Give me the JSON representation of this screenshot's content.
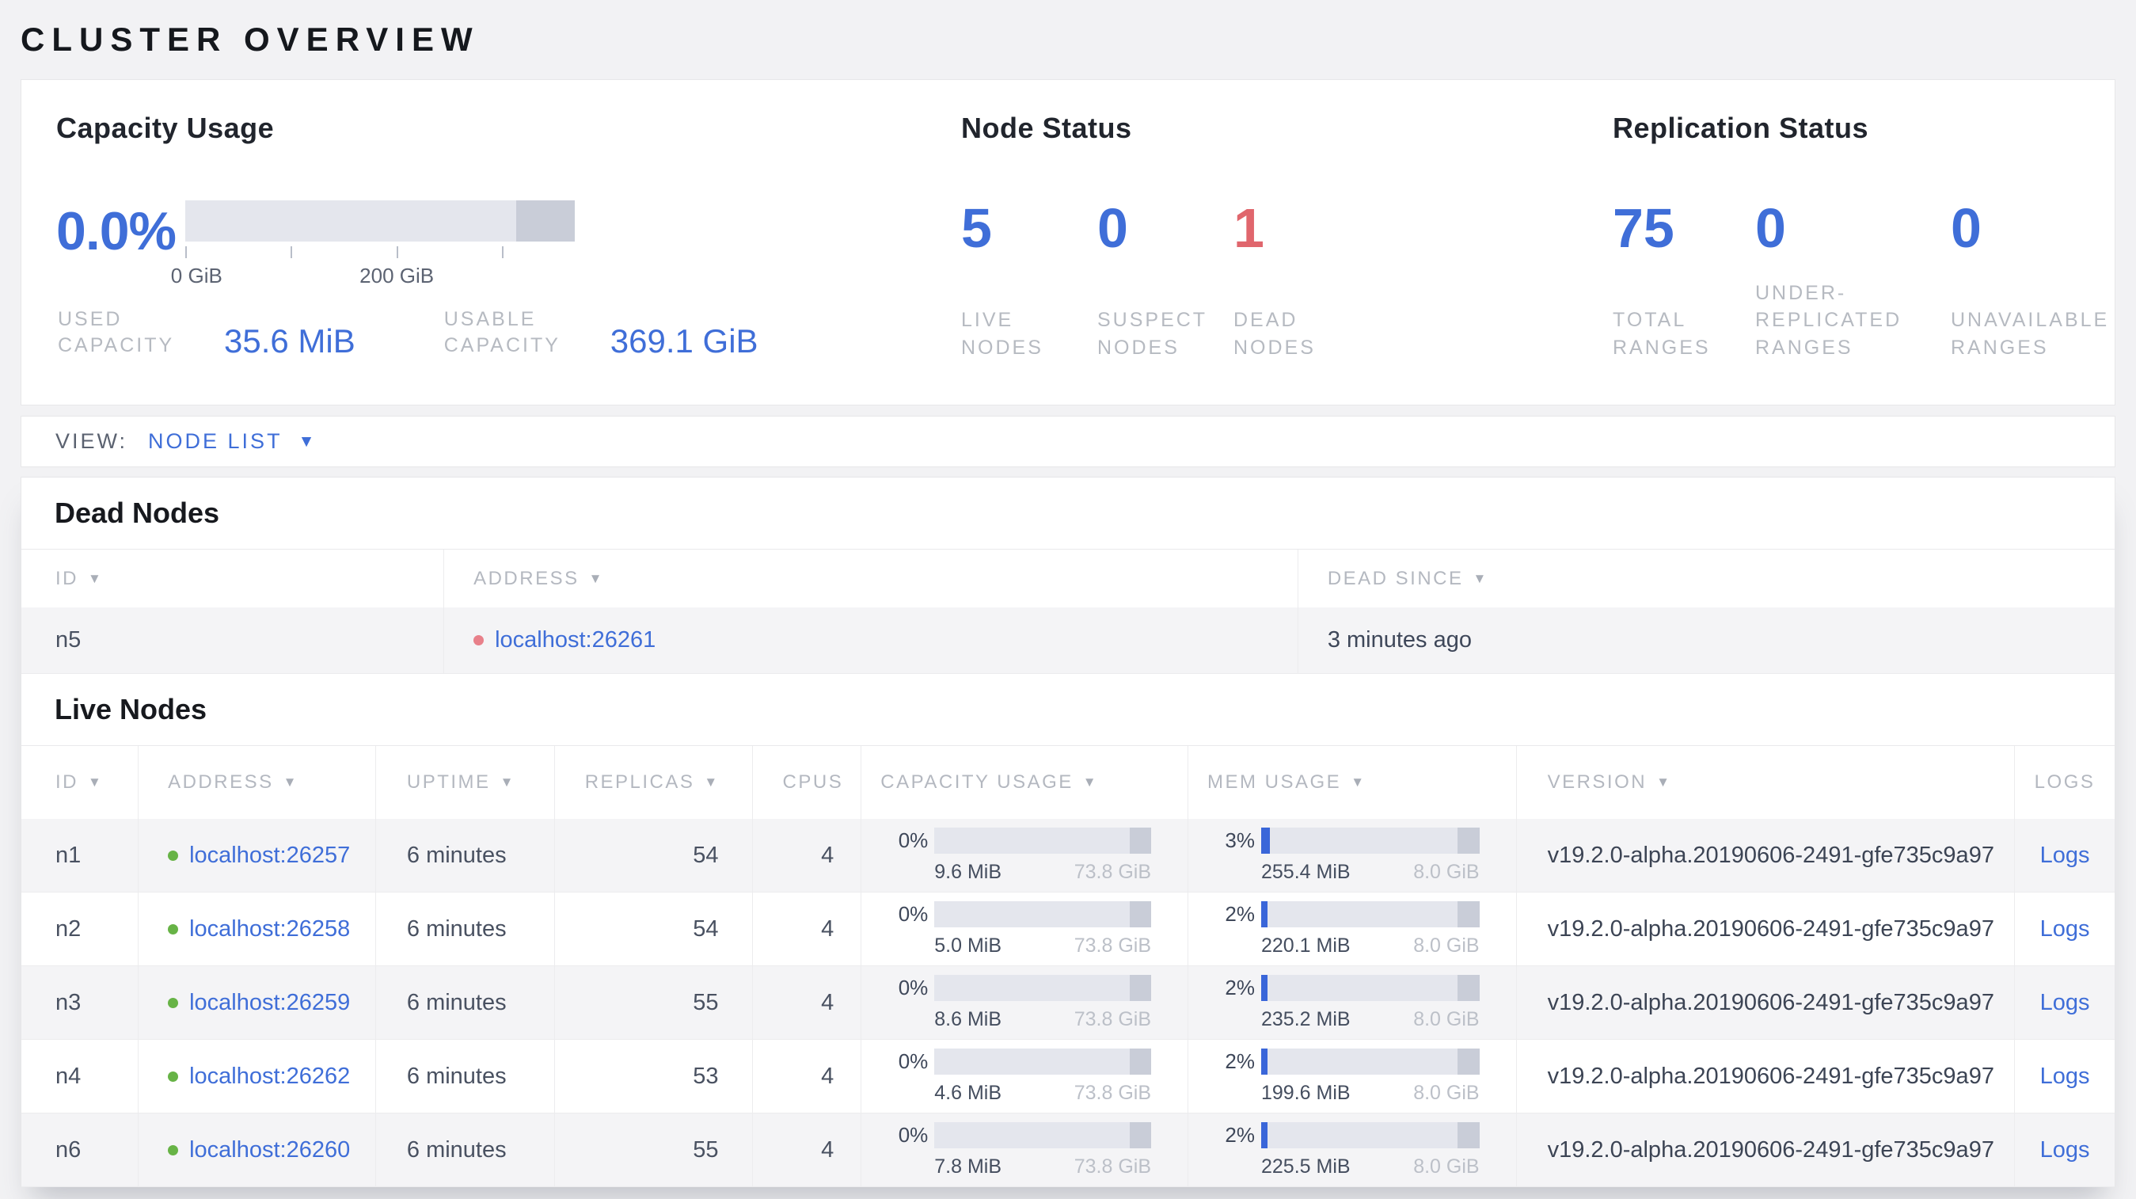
{
  "page_title": "CLUSTER OVERVIEW",
  "colors": {
    "accent_blue": "#3f6ed8",
    "danger_red": "#e0666d",
    "live_dot_green": "#67b346",
    "dead_dot_red": "#e8808a",
    "bar_track": "#e4e6ed",
    "bar_end_segment": "#c9cdd8",
    "bar_fill_blue": "#3a66d9"
  },
  "icons": {
    "sort_desc": "▼",
    "dropdown_caret": "▼"
  },
  "summary": {
    "capacity": {
      "title": "Capacity Usage",
      "percent": "0.0%",
      "axis_tick_labels": [
        "0 GiB",
        "200 GiB"
      ],
      "used_label": "USED CAPACITY",
      "used_value": "35.6 MiB",
      "usable_label": "USABLE CAPACITY",
      "usable_value": "369.1 GiB"
    },
    "node_status": {
      "title": "Node Status",
      "metrics": [
        {
          "value": "5",
          "label": "LIVE NODES"
        },
        {
          "value": "0",
          "label": "SUSPECT NODES"
        },
        {
          "value": "1",
          "label": "DEAD NODES"
        }
      ]
    },
    "replication": {
      "title": "Replication Status",
      "metrics": [
        {
          "value": "75",
          "label": "TOTAL RANGES"
        },
        {
          "value": "0",
          "label": "UNDER-REPLICATED RANGES"
        },
        {
          "value": "0",
          "label": "UNAVAILABLE RANGES"
        }
      ]
    }
  },
  "view_bar": {
    "label": "VIEW:",
    "selected": "NODE LIST"
  },
  "dead_nodes": {
    "title": "Dead Nodes",
    "columns": [
      {
        "label": "ID"
      },
      {
        "label": "ADDRESS"
      },
      {
        "label": "DEAD SINCE"
      }
    ],
    "rows": [
      {
        "id": "n5",
        "address": "localhost:26261",
        "dead_since": "3 minutes ago"
      }
    ]
  },
  "live_nodes": {
    "title": "Live Nodes",
    "columns": [
      {
        "label": "ID"
      },
      {
        "label": "ADDRESS"
      },
      {
        "label": "UPTIME"
      },
      {
        "label": "REPLICAS"
      },
      {
        "label": "CPUS"
      },
      {
        "label": "CAPACITY USAGE"
      },
      {
        "label": "MEM USAGE"
      },
      {
        "label": "VERSION"
      },
      {
        "label": "LOGS"
      }
    ],
    "logs_label": "Logs",
    "rows": [
      {
        "id": "n1",
        "address": "localhost:26257",
        "uptime": "6 minutes",
        "replicas": "54",
        "cpus": "4",
        "cap_pct": "0%",
        "cap_used": "9.6 MiB",
        "cap_total": "73.8 GiB",
        "cap_fill": "0",
        "mem_pct": "3%",
        "mem_used": "255.4 MiB",
        "mem_total": "8.0 GiB",
        "mem_fill": "4",
        "version": "v19.2.0-alpha.20190606-2491-gfe735c9a97"
      },
      {
        "id": "n2",
        "address": "localhost:26258",
        "uptime": "6 minutes",
        "replicas": "54",
        "cpus": "4",
        "cap_pct": "0%",
        "cap_used": "5.0 MiB",
        "cap_total": "73.8 GiB",
        "cap_fill": "0",
        "mem_pct": "2%",
        "mem_used": "220.1 MiB",
        "mem_total": "8.0 GiB",
        "mem_fill": "3",
        "version": "v19.2.0-alpha.20190606-2491-gfe735c9a97"
      },
      {
        "id": "n3",
        "address": "localhost:26259",
        "uptime": "6 minutes",
        "replicas": "55",
        "cpus": "4",
        "cap_pct": "0%",
        "cap_used": "8.6 MiB",
        "cap_total": "73.8 GiB",
        "cap_fill": "0",
        "mem_pct": "2%",
        "mem_used": "235.2 MiB",
        "mem_total": "8.0 GiB",
        "mem_fill": "3",
        "version": "v19.2.0-alpha.20190606-2491-gfe735c9a97"
      },
      {
        "id": "n4",
        "address": "localhost:26262",
        "uptime": "6 minutes",
        "replicas": "53",
        "cpus": "4",
        "cap_pct": "0%",
        "cap_used": "4.6 MiB",
        "cap_total": "73.8 GiB",
        "cap_fill": "0",
        "mem_pct": "2%",
        "mem_used": "199.6 MiB",
        "mem_total": "8.0 GiB",
        "mem_fill": "3",
        "version": "v19.2.0-alpha.20190606-2491-gfe735c9a97"
      },
      {
        "id": "n6",
        "address": "localhost:26260",
        "uptime": "6 minutes",
        "replicas": "55",
        "cpus": "4",
        "cap_pct": "0%",
        "cap_used": "7.8 MiB",
        "cap_total": "73.8 GiB",
        "cap_fill": "0",
        "mem_pct": "2%",
        "mem_used": "225.5 MiB",
        "mem_total": "8.0 GiB",
        "mem_fill": "3",
        "version": "v19.2.0-alpha.20190606-2491-gfe735c9a97"
      }
    ]
  }
}
